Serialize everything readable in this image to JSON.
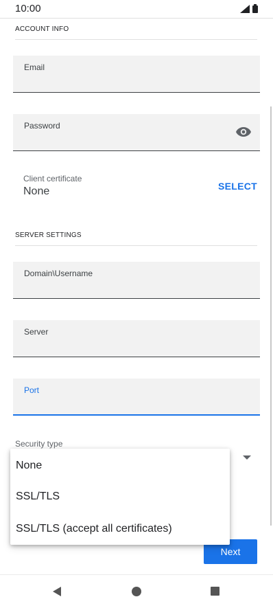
{
  "status": {
    "time": "10:00"
  },
  "account": {
    "section_title": "ACCOUNT INFO",
    "email_label": "Email",
    "password_label": "Password",
    "client_cert_label": "Client certificate",
    "client_cert_value": "None",
    "select_label": "SELECT"
  },
  "server": {
    "section_title": "SERVER SETTINGS",
    "domain_label": "Domain\\Username",
    "server_label": "Server",
    "port_label": "Port",
    "security_type_label": "Security type"
  },
  "security_menu": {
    "options": [
      "None",
      "SSL/TLS",
      "SSL/TLS (accept all certificates)"
    ]
  },
  "actions": {
    "next_label": "Next"
  },
  "colors": {
    "accent": "#1a73e8",
    "field_bg": "#f2f2f2"
  },
  "icons": {
    "password_toggle": "eye-icon",
    "nav_back": "back-icon",
    "nav_home": "home-icon",
    "nav_recent": "recents-icon"
  }
}
